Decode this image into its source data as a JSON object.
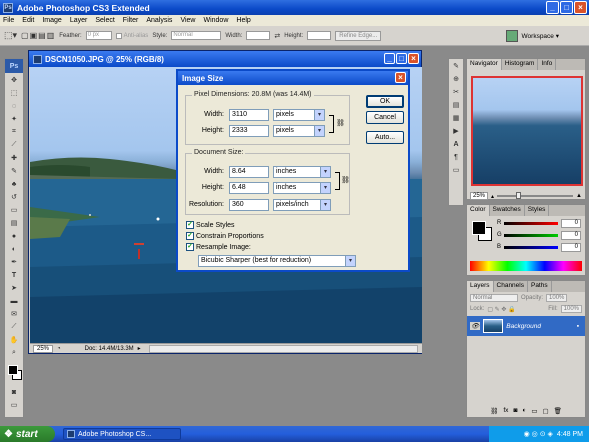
{
  "app": {
    "title": "Adobe Photoshop CS3 Extended",
    "logo": "Ps"
  },
  "menu": [
    "File",
    "Edit",
    "Image",
    "Layer",
    "Select",
    "Filter",
    "Analysis",
    "View",
    "Window",
    "Help"
  ],
  "options": {
    "feather_label": "Feather:",
    "feather_value": "0 px",
    "antialias": "Anti-alias",
    "style_label": "Style:",
    "style_value": "Normal",
    "width_label": "Width:",
    "height_label": "Height:",
    "refine": "Refine Edge...",
    "workspace": "Workspace"
  },
  "document": {
    "title": "DSCN1050.JPG @ 25% (RGB/8)",
    "zoom": "25%",
    "docsize": "Doc: 14.4M/13.3M"
  },
  "dialog": {
    "title": "Image Size",
    "pixel_dims_label": "Pixel Dimensions:",
    "pixel_dims_value": "20.8M (was 14.4M)",
    "px_width_label": "Width:",
    "px_width": "3110",
    "px_width_unit": "pixels",
    "px_height_label": "Height:",
    "px_height": "2333",
    "px_height_unit": "pixels",
    "doc_size_label": "Document Size:",
    "doc_width_label": "Width:",
    "doc_width": "8.64",
    "doc_width_unit": "inches",
    "doc_height_label": "Height:",
    "doc_height": "6.48",
    "doc_height_unit": "inches",
    "res_label": "Resolution:",
    "res_value": "360",
    "res_unit": "pixels/inch",
    "scale_styles": "Scale Styles",
    "constrain": "Constrain Proportions",
    "resample": "Resample Image:",
    "resample_method": "Bicubic Sharper (best for reduction)",
    "ok": "OK",
    "cancel": "Cancel",
    "auto": "Auto..."
  },
  "navigator": {
    "tabs": [
      "Navigator",
      "Histogram",
      "Info"
    ],
    "zoom": "25%"
  },
  "color": {
    "tabs": [
      "Color",
      "Swatches",
      "Styles"
    ],
    "r_label": "R",
    "g_label": "G",
    "b_label": "B",
    "r": "0",
    "g": "0",
    "b": "0"
  },
  "layers": {
    "tabs": [
      "Layers",
      "Channels",
      "Paths"
    ],
    "mode": "Normal",
    "opacity_label": "Opacity:",
    "opacity": "100%",
    "lock_label": "Lock:",
    "fill_label": "Fill:",
    "fill": "100%",
    "layer_name": "Background"
  },
  "taskbar": {
    "start": "start",
    "task": "Adobe Photoshop CS...",
    "clock": "4:48 PM"
  },
  "colors": {
    "accent": "#0b4ac8",
    "dialog_bg": "#ece9d8"
  }
}
